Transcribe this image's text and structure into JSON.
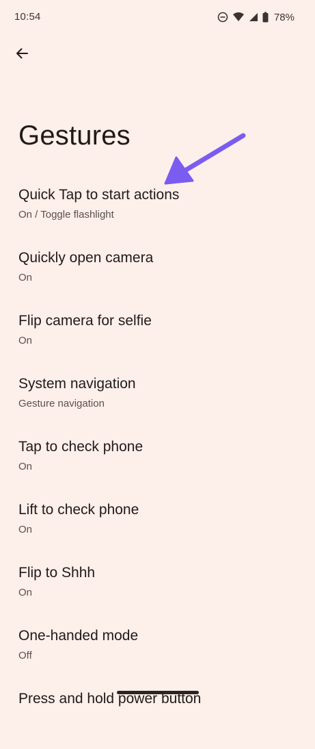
{
  "status_bar": {
    "time": "10:54",
    "battery_percent": "78%",
    "icons": [
      "do-not-disturb-icon",
      "wifi-icon",
      "cellular-signal-icon",
      "battery-icon"
    ]
  },
  "header": {
    "back_icon": "arrow-left-icon",
    "title": "Gestures"
  },
  "settings": {
    "items": [
      {
        "title": "Quick Tap to start actions",
        "summary": "On / Toggle flashlight"
      },
      {
        "title": "Quickly open camera",
        "summary": "On"
      },
      {
        "title": "Flip camera for selfie",
        "summary": "On"
      },
      {
        "title": "System navigation",
        "summary": "Gesture navigation"
      },
      {
        "title": "Tap to check phone",
        "summary": "On"
      },
      {
        "title": "Lift to check phone",
        "summary": "On"
      },
      {
        "title": "Flip to Shhh",
        "summary": "On"
      },
      {
        "title": "One-handed mode",
        "summary": "Off"
      },
      {
        "title": "Press and hold power button",
        "summary": ""
      }
    ]
  },
  "colors": {
    "background": "#fdefea",
    "annotation_arrow": "#7b5cf0",
    "text_primary": "#201a18",
    "text_secondary": "#5a514d"
  }
}
